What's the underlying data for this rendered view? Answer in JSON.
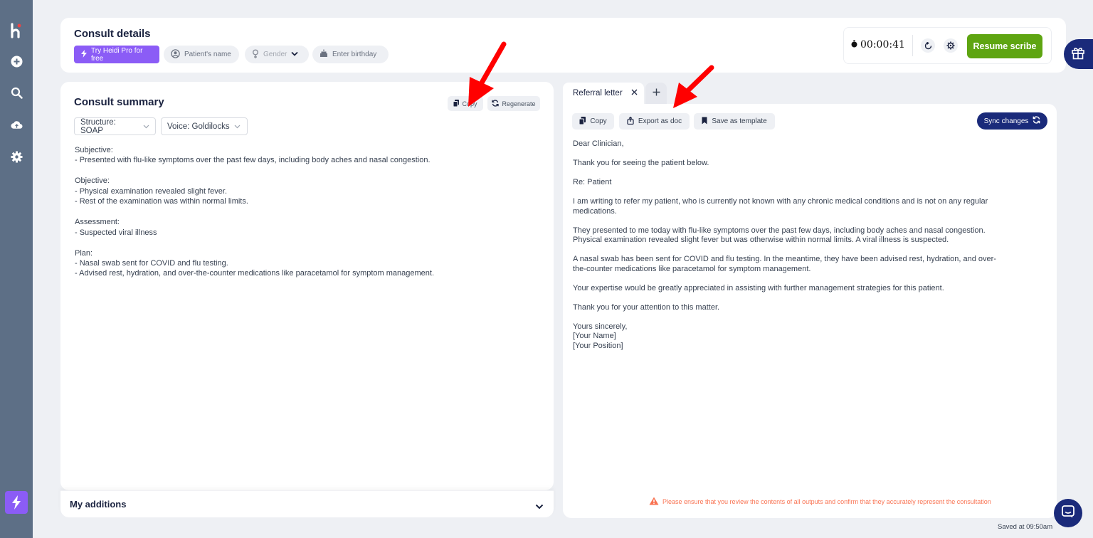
{
  "sidebar": {
    "items": [
      {
        "icon": "logo-icon"
      },
      {
        "icon": "add-icon"
      },
      {
        "icon": "search-icon"
      },
      {
        "icon": "upload-cloud-icon"
      },
      {
        "icon": "settings-icon"
      },
      {
        "icon": "bolt-icon"
      }
    ]
  },
  "header": {
    "title": "Consult details",
    "pro_label": "Try Heidi Pro for free",
    "patient_placeholder": "Patient's name",
    "gender_placeholder": "Gender",
    "birthday_placeholder": "Enter birthday",
    "timer": "00:00:41",
    "resume_label": "Resume scribe"
  },
  "summary": {
    "title": "Consult summary",
    "copy_label": "Copy",
    "regenerate_label": "Regenerate",
    "structure_label": "Structure: SOAP",
    "voice_label": "Voice: Goldilocks",
    "sections": [
      {
        "heading": "Subjective:",
        "lines": [
          "- Presented with flu-like symptoms over the past few days, including body aches and nasal congestion."
        ]
      },
      {
        "heading": "Objective:",
        "lines": [
          "- Physical examination revealed slight fever.",
          "- Rest of the examination was within normal limits."
        ]
      },
      {
        "heading": "Assessment:",
        "lines": [
          "- Suspected viral illness"
        ]
      },
      {
        "heading": "Plan:",
        "lines": [
          "- Nasal swab sent for COVID and flu testing.",
          "- Advised rest, hydration, and over-the-counter medications like paracetamol for symptom management."
        ]
      }
    ]
  },
  "additions": {
    "title": "My additions"
  },
  "letter": {
    "tab_label": "Referral letter",
    "copy_label": "Copy",
    "export_label": "Export as doc",
    "save_template_label": "Save as template",
    "sync_label": "Sync changes",
    "paragraphs": [
      [
        "Dear Clinician,"
      ],
      [
        "Thank you for seeing the patient below."
      ],
      [
        "Re: Patient"
      ],
      [
        "I am writing to refer my patient, who is currently not known with any chronic medical conditions and is not on any regular",
        "medications."
      ],
      [
        "They presented to me today with flu-like symptoms over the past few days, including body aches and nasal congestion.",
        "Physical examination revealed slight fever but was otherwise within normal limits. A viral illness is suspected."
      ],
      [
        "A nasal swab has been sent for COVID and flu testing. In the meantime, they have been advised rest, hydration, and over-",
        "the-counter medications like paracetamol for symptom management."
      ],
      [
        "Your expertise would be greatly appreciated in assisting with further management strategies for this patient."
      ],
      [
        "Thank you for your attention to this matter."
      ],
      [
        "Yours sincerely,",
        "[Your Name]",
        "[Your Position]"
      ]
    ],
    "warning": "Please ensure that you review the contents of all outputs and confirm that they accurately represent the consultation"
  },
  "footer": {
    "saved": "Saved at 09:50am"
  },
  "colors": {
    "sidebar": "#5d6f86",
    "accent_purple": "#8b5cf6",
    "accent_green": "#5ea511",
    "navy": "#1a2a7a",
    "warning": "#f97352",
    "annotation_arrow": "#ff0000"
  }
}
